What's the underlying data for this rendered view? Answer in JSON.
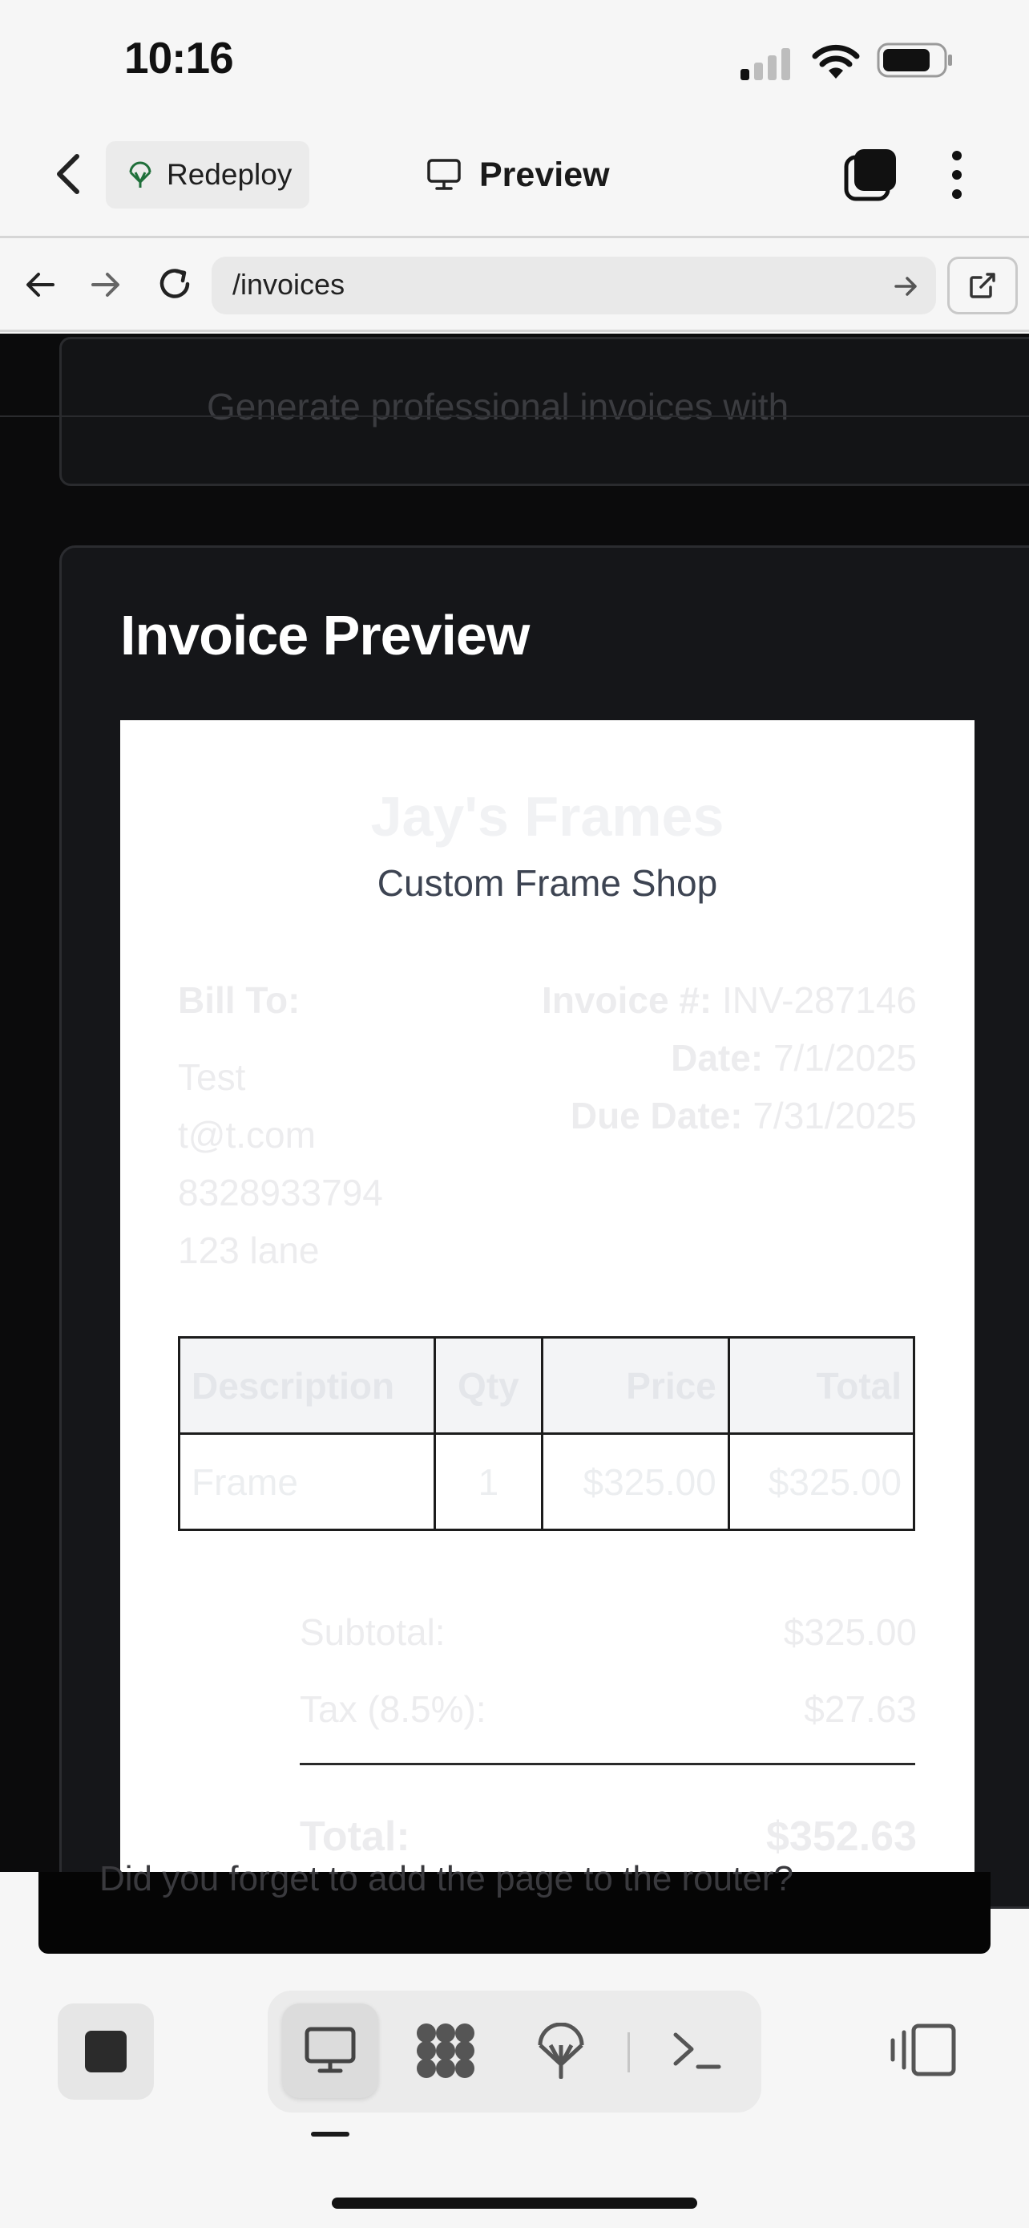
{
  "status_bar": {
    "time": "10:16"
  },
  "header": {
    "redeploy_label": "Redeploy",
    "title": "Preview"
  },
  "address_bar": {
    "url": "/invoices"
  },
  "content": {
    "top_card_text": "Generate professional invoices with",
    "card_title": "Invoice Preview",
    "invoice": {
      "company": "Jay's Frames",
      "tagline": "Custom Frame Shop",
      "bill_to_label": "Bill To:",
      "client": {
        "name": "Test",
        "email": "t@t.com",
        "phone": "8328933794",
        "address": "123 lane"
      },
      "invoice_number_label": "Invoice #:",
      "invoice_number": "INV-287146",
      "date_label": "Date:",
      "date": "7/1/2025",
      "due_date_label": "Due Date:",
      "due_date": "7/31/2025",
      "table": {
        "headers": [
          "Description",
          "Qty",
          "Price",
          "Total"
        ],
        "rows": [
          [
            "Frame",
            "1",
            "$325.00",
            "$325.00"
          ]
        ]
      },
      "subtotal_label": "Subtotal:",
      "subtotal": "$325.00",
      "tax_label": "Tax (8.5%):",
      "tax": "$27.63",
      "total_label": "Total:",
      "total": "$352.63"
    },
    "toast_text": "Did you forget to add the page to the router?"
  },
  "colors": {
    "page_bg": "#0b0b0c",
    "card_bg": "#151619",
    "invoice_tagline": "#3d4452"
  }
}
